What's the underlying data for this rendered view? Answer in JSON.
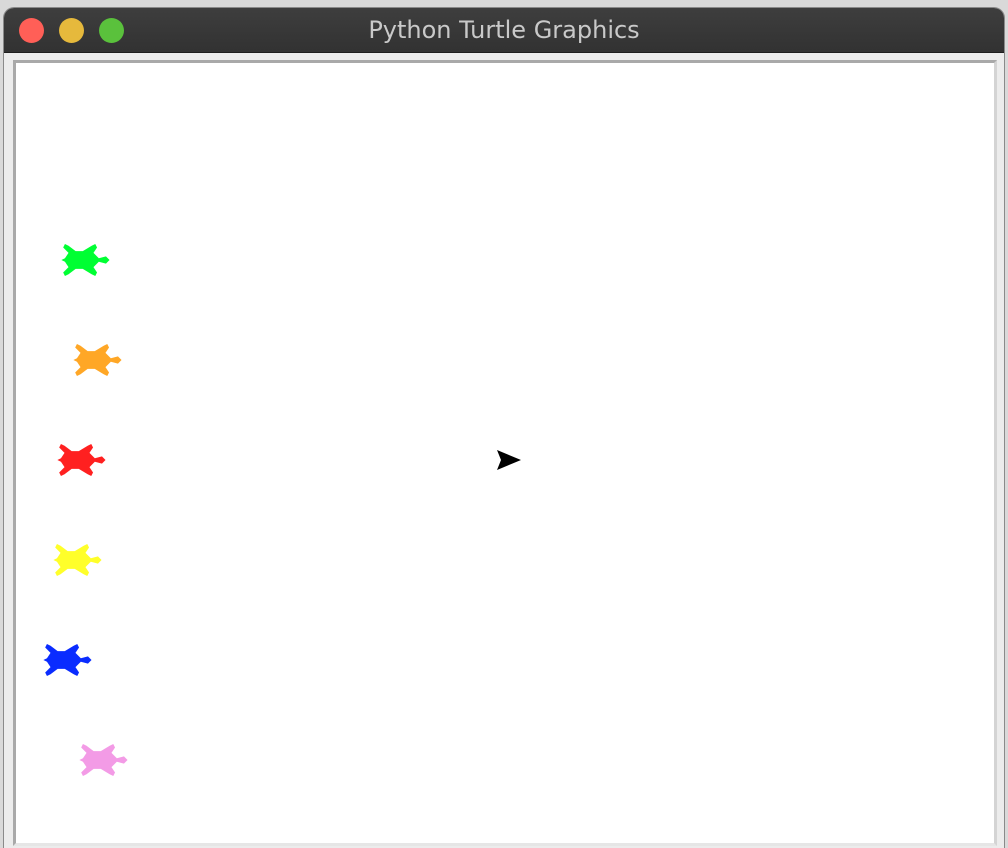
{
  "window": {
    "title": "Python Turtle Graphics",
    "buttons": [
      {
        "name": "close-button",
        "color": "#ff5f57"
      },
      {
        "name": "minimize-button",
        "color": "#e6b93c"
      },
      {
        "name": "zoom-button",
        "color": "#5ac13c"
      }
    ]
  },
  "canvas": {
    "background": "#ffffff",
    "turtles": [
      {
        "shape": "turtle",
        "color": "#00ff33"
      },
      {
        "shape": "turtle",
        "color": "#ffa726"
      },
      {
        "shape": "turtle",
        "color": "#ff2020"
      },
      {
        "shape": "turtle",
        "color": "#ffff2a"
      },
      {
        "shape": "turtle",
        "color": "#0a2cff"
      },
      {
        "shape": "turtle",
        "color": "#f39be6"
      }
    ],
    "cursor": {
      "shape": "classic",
      "color": "#000000"
    }
  }
}
